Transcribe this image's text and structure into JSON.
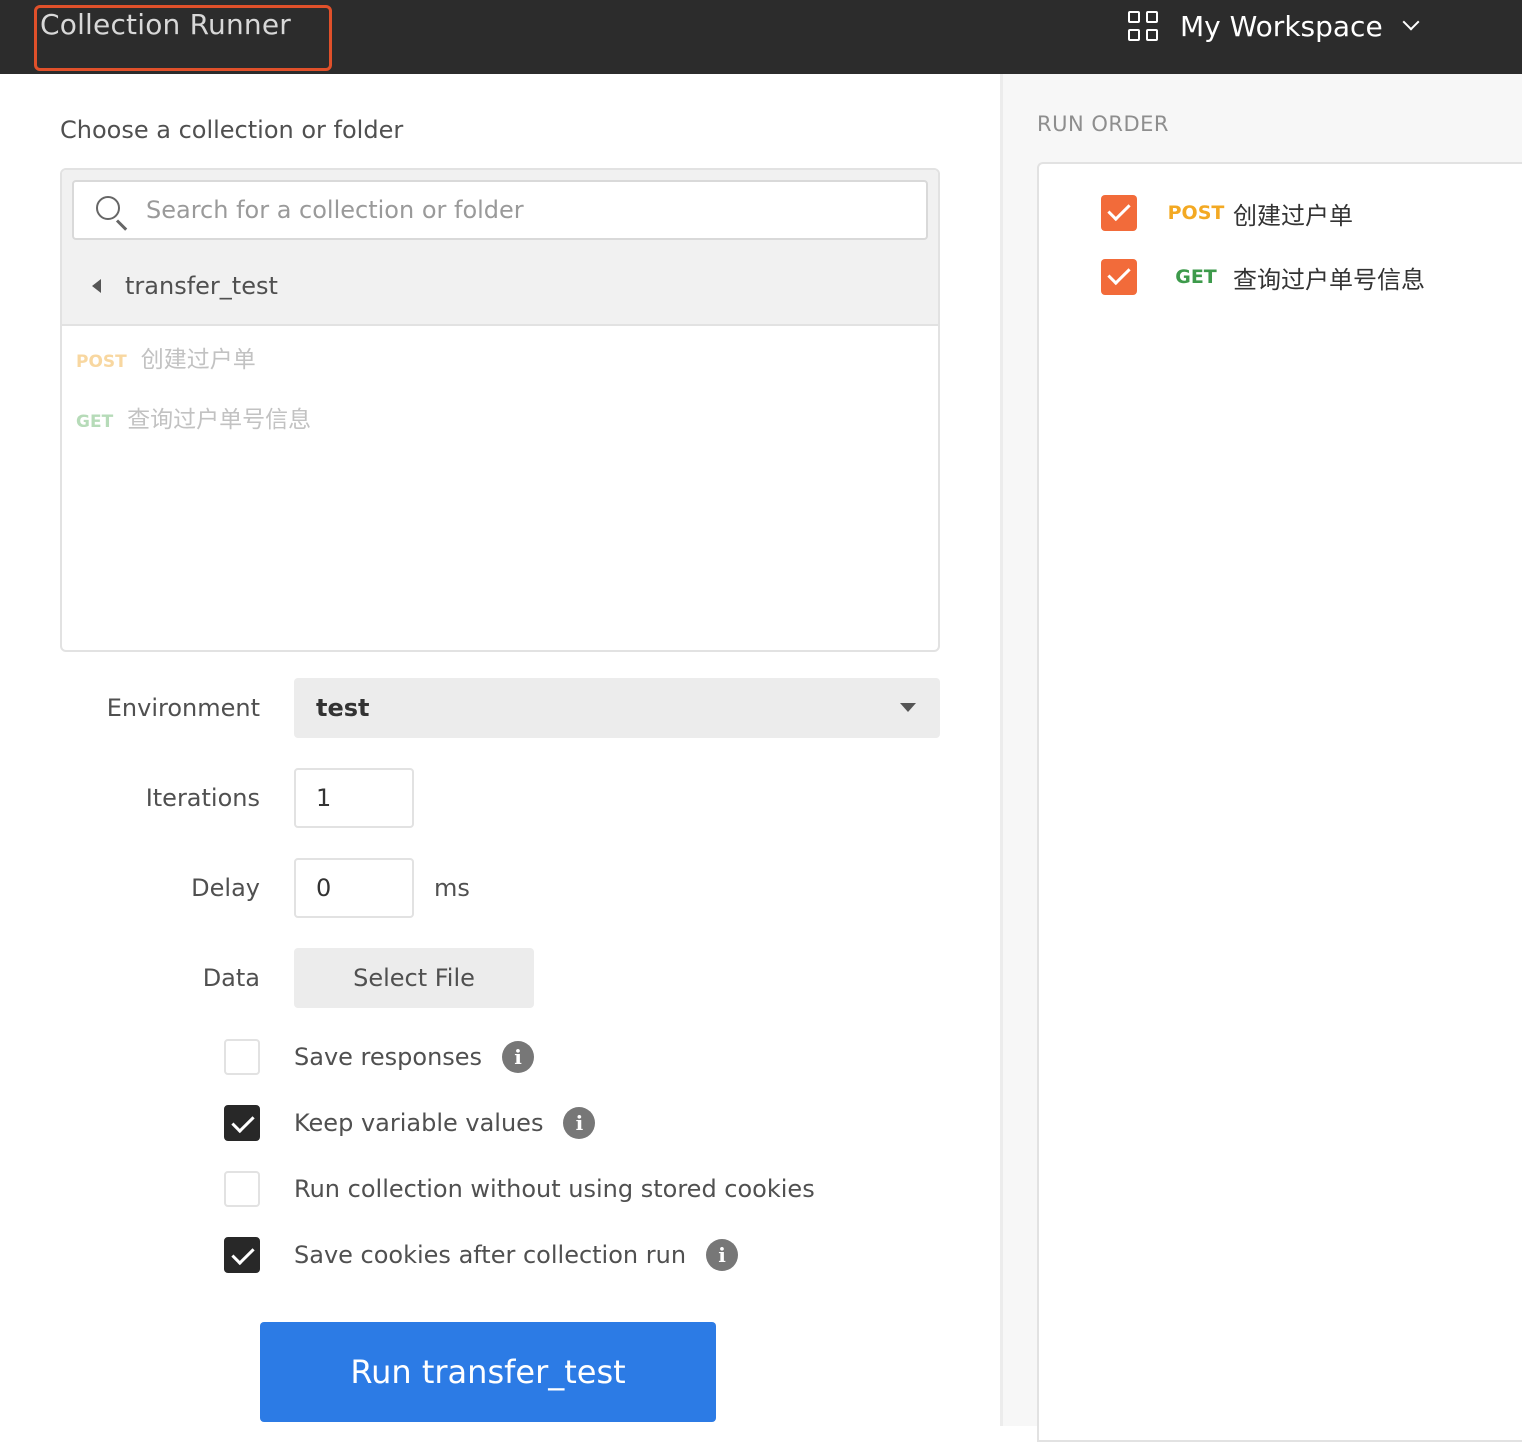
{
  "header": {
    "title": "Collection Runner",
    "workspace_label": "My Workspace",
    "workspace_icon": "grid-icon"
  },
  "colors": {
    "topbar": "#2c2c2c",
    "highlight": "#e0502a",
    "primary_button": "#2c7be5",
    "run_order_check": "#f26b3a",
    "post": "#f3a923",
    "get": "#3d9a4b"
  },
  "chooser": {
    "label": "Choose a collection or folder",
    "search_placeholder": "Search for a collection or folder",
    "folder_name": "transfer_test",
    "requests": [
      {
        "method": "POST",
        "name": "创建过户单"
      },
      {
        "method": "GET",
        "name": "查询过户单号信息"
      }
    ]
  },
  "form": {
    "environment_label": "Environment",
    "environment_value": "test",
    "iterations_label": "Iterations",
    "iterations_value": "1",
    "delay_label": "Delay",
    "delay_value": "0",
    "delay_unit": "ms",
    "data_label": "Data",
    "data_button": "Select File"
  },
  "options": [
    {
      "label": "Save responses",
      "checked": false,
      "info": true
    },
    {
      "label": "Keep variable values",
      "checked": true,
      "info": true
    },
    {
      "label": "Run collection without using stored cookies",
      "checked": false,
      "info": false
    },
    {
      "label": "Save cookies after collection run",
      "checked": true,
      "info": true
    }
  ],
  "run_button": "Run transfer_test",
  "run_order": {
    "title": "RUN ORDER",
    "items": [
      {
        "method": "POST",
        "name": "创建过户单",
        "checked": true
      },
      {
        "method": "GET",
        "name": "查询过户单号信息",
        "checked": true
      }
    ]
  }
}
